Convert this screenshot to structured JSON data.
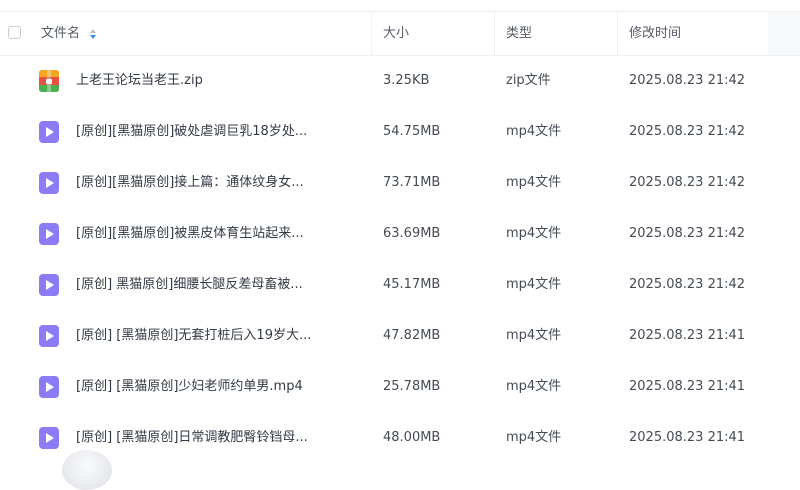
{
  "columns": {
    "name": "文件名",
    "size": "大小",
    "type": "类型",
    "time": "修改时间"
  },
  "files": [
    {
      "name": "上老王论坛当老王.zip",
      "size": "3.25KB",
      "type": "zip文件",
      "time": "2025.08.23 21:42",
      "icon": "zip-archive-icon"
    },
    {
      "name": "[原创][黑猫原创]破处虐调巨乳18岁处...",
      "size": "54.75MB",
      "type": "mp4文件",
      "time": "2025.08.23 21:42",
      "icon": "video-file-icon"
    },
    {
      "name": "[原创][黑猫原创]接上篇：通体纹身女...",
      "size": "73.71MB",
      "type": "mp4文件",
      "time": "2025.08.23 21:42",
      "icon": "video-file-icon"
    },
    {
      "name": "[原创][黑猫原创]被黑皮体育生站起来...",
      "size": "63.69MB",
      "type": "mp4文件",
      "time": "2025.08.23 21:42",
      "icon": "video-file-icon"
    },
    {
      "name": "[原创] 黑猫原创]细腰长腿反差母畜被...",
      "size": "45.17MB",
      "type": "mp4文件",
      "time": "2025.08.23 21:42",
      "icon": "video-file-icon"
    },
    {
      "name": "[原创] [黑猫原创]无套打桩后入19岁大...",
      "size": "47.82MB",
      "type": "mp4文件",
      "time": "2025.08.23 21:41",
      "icon": "video-file-icon"
    },
    {
      "name": "[原创] [黑猫原创]少妇老师约单男.mp4",
      "size": "25.78MB",
      "type": "mp4文件",
      "time": "2025.08.23 21:41",
      "icon": "video-file-icon"
    },
    {
      "name": "[原创] [黑猫原创]日常调教肥臀铃铛母...",
      "size": "48.00MB",
      "type": "mp4文件",
      "time": "2025.08.23 21:41",
      "icon": "video-file-icon"
    }
  ],
  "colors": {
    "video_icon": "#8b7cf6",
    "zip_icon_top": "#f5a623",
    "zip_icon_mid": "#e8513f",
    "zip_icon_bottom": "#4caf50",
    "sort_active": "#3b8cf7"
  }
}
